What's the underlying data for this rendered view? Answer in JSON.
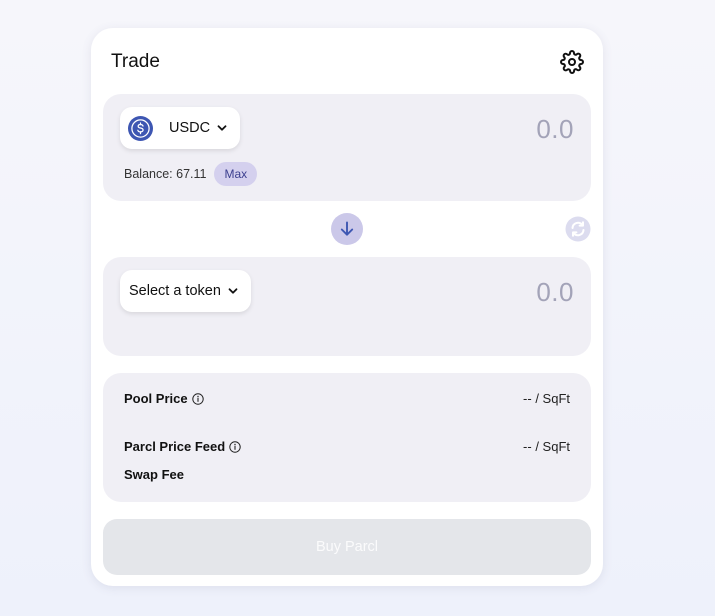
{
  "header": {
    "title": "Trade",
    "settings_icon": "gear-icon"
  },
  "from_panel": {
    "token_symbol": "USDC",
    "token_icon": "usdc-logo-icon",
    "amount_placeholder": "0.0",
    "balance_text": "Balance: 67.11",
    "max_label": "Max"
  },
  "to_panel": {
    "select_label": "Select a token",
    "amount_placeholder": "0.0"
  },
  "swap": {
    "arrow_icon": "arrow-down-icon",
    "refresh_icon": "refresh-icon"
  },
  "info": {
    "pool_price_label": "Pool Price",
    "pool_price_value": "-- / SqFt",
    "feed_label": "Parcl Price Feed",
    "feed_value": "-- / SqFt",
    "swap_fee_label": "Swap Fee"
  },
  "action": {
    "buy_label": "Buy Parcl"
  },
  "colors": {
    "accent": "#3d56b2",
    "max_bg": "#d4d0ee",
    "panel_bg": "#f0eff5",
    "placeholder": "#a3a3b8"
  }
}
